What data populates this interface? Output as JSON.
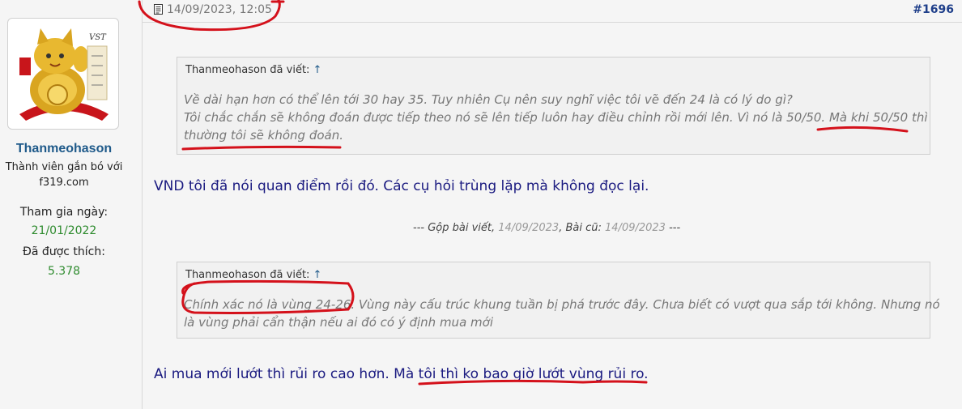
{
  "user": {
    "name": "Thanmeohason",
    "title_line1": "Thành viên gắn bó với",
    "title_line2": "f319.com",
    "join_label": "Tham gia ngày:",
    "join_date": "21/01/2022",
    "likes_label": "Đã được thích:",
    "likes_count": "5.378",
    "avatar_text": "VST"
  },
  "post": {
    "date": "14/09/2023, 12:05",
    "number": "#1696"
  },
  "quote1": {
    "author_line": "Thanmeohason đã viết:",
    "arrow": "↑",
    "line1": "Về dài hạn hơn có thể lên tới 30 hay 35. Tuy nhiên Cụ nên suy nghĩ việc tôi vẽ đến 24 là có lý do gì?",
    "line2": "Tôi chắc chắn sẽ không đoán được tiếp theo nó sẽ lên tiếp luôn hay điều chỉnh rồi mới lên. Vì nó là 50/50. Mà khi 50/50 thì",
    "line3": "thường tôi sẽ không đoán."
  },
  "reply1": "VND tôi đã nói quan điểm rồi đó. Các cụ hỏi trùng lặp mà không đọc lại.",
  "merge": {
    "prefix": "--- Gộp bài viết,",
    "date1": "14/09/2023",
    "middle": ", Bài cũ:",
    "date2": "14/09/2023",
    "suffix": "---"
  },
  "quote2": {
    "author_line": "Thanmeohason đã viết:",
    "arrow": "↑",
    "line1": "Chính xác nó là vùng 24-26. Vùng này cấu trúc khung tuần bị phá trước đây. Chưa biết có vượt qua sắp tới không. Nhưng nó",
    "line2": "là vùng phải cẩn thận nếu ai đó có ý định mua mới"
  },
  "reply2": "Ai mua mới lướt thì rủi ro cao hơn. Mà tôi thì ko bao giờ lướt vùng rủi ro.",
  "colors": {
    "username": "#1f5a8a",
    "value_green": "#2e8b2e",
    "message_text": "#1a1a80",
    "ink_red": "#d4111b"
  }
}
